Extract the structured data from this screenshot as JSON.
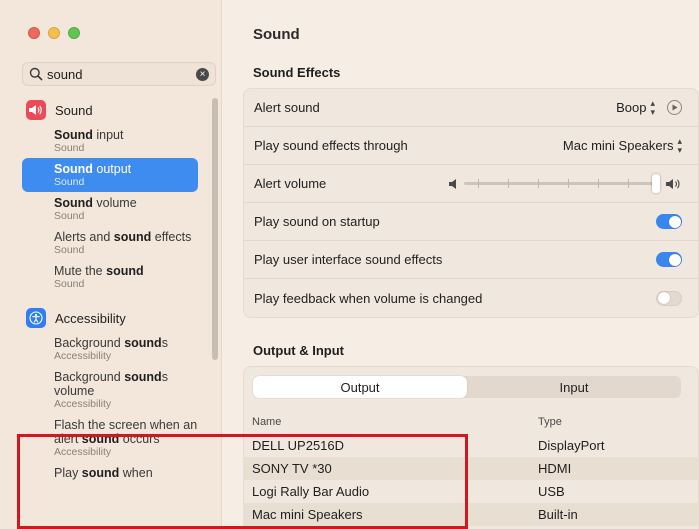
{
  "sidebar": {
    "search": {
      "value": "sound",
      "placeholder": "Search"
    },
    "categories": [
      {
        "label": "Sound",
        "icon": "speaker-icon",
        "color": "#ea4b56",
        "items": [
          {
            "pre": "",
            "bold": "Sound",
            "post": " input",
            "path": "Sound"
          },
          {
            "pre": "",
            "bold": "Sound",
            "post": " output",
            "path": "Sound",
            "selected": true
          },
          {
            "pre": "",
            "bold": "Sound",
            "post": " volume",
            "path": "Sound"
          },
          {
            "pre": "Alerts and ",
            "bold": "sound",
            "post": " effects",
            "path": "Sound"
          },
          {
            "pre": "Mute the ",
            "bold": "sound",
            "post": "",
            "path": "Sound"
          }
        ]
      },
      {
        "label": "Accessibility",
        "icon": "accessibility-icon",
        "color": "#2f7ef3",
        "items": [
          {
            "pre": "Background ",
            "bold": "sound",
            "post": "s",
            "path": "Accessibility"
          },
          {
            "pre": "Background ",
            "bold": "sound",
            "post": "s volume",
            "path": "Accessibility"
          },
          {
            "pre": "Flash the screen when an alert ",
            "bold": "sound",
            "post": " occurs",
            "path": "Accessibility"
          },
          {
            "pre": "Play ",
            "bold": "sound",
            "post": " when",
            "path": ""
          }
        ]
      }
    ]
  },
  "main": {
    "title": "Sound",
    "sound_effects": {
      "heading": "Sound Effects",
      "alert_sound": {
        "label": "Alert sound",
        "value": "Boop"
      },
      "play_through": {
        "label": "Play sound effects through",
        "value": "Mac mini Speakers"
      },
      "alert_volume": {
        "label": "Alert volume",
        "level": 1.0
      },
      "startup": {
        "label": "Play sound on startup",
        "on": true
      },
      "ui_effects": {
        "label": "Play user interface sound effects",
        "on": true
      },
      "feedback": {
        "label": "Play feedback when volume is changed",
        "on": false
      }
    },
    "output_input": {
      "heading": "Output & Input",
      "tabs": [
        "Output",
        "Input"
      ],
      "active_tab": "Output",
      "columns": {
        "name": "Name",
        "type": "Type"
      },
      "devices": [
        {
          "name": "DELL UP2516D",
          "type": "DisplayPort"
        },
        {
          "name": "SONY TV  *30",
          "type": "HDMI"
        },
        {
          "name": "Logi Rally Bar Audio",
          "type": "USB"
        },
        {
          "name": "Mac mini Speakers",
          "type": "Built-in"
        }
      ]
    }
  },
  "colors": {
    "accent": "#3f8cf0",
    "highlight": "#d3171f"
  }
}
